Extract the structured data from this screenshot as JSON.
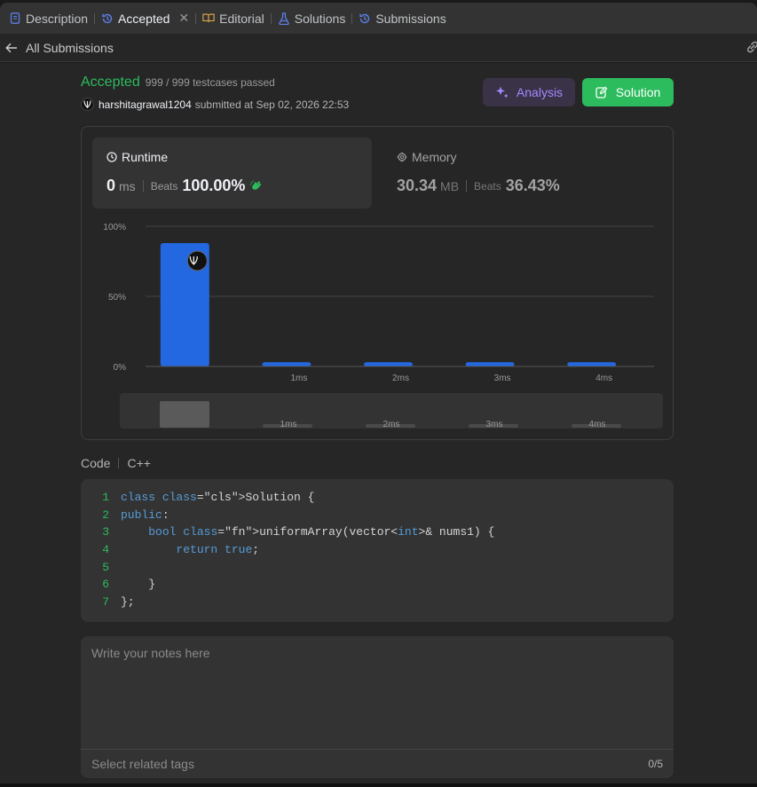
{
  "tabs": [
    {
      "label": "Description",
      "icon": "description-icon"
    },
    {
      "label": "Accepted",
      "icon": "history-icon",
      "active": true
    },
    {
      "label": "Editorial",
      "icon": "book-icon"
    },
    {
      "label": "Solutions",
      "icon": "flask-icon"
    },
    {
      "label": "Submissions",
      "icon": "history-icon"
    }
  ],
  "subheader": {
    "back_label": "All Submissions"
  },
  "submission": {
    "status": "Accepted",
    "testcases": "999 / 999 testcases passed",
    "username": "harshitagrawal1204",
    "submitted": "submitted at Sep 02, 2026 22:53"
  },
  "buttons": {
    "analysis": "Analysis",
    "solution": "Solution"
  },
  "runtime": {
    "title": "Runtime",
    "value": "0",
    "unit": "ms",
    "beats_label": "Beats",
    "beats": "100.00%"
  },
  "memory": {
    "title": "Memory",
    "value": "30.34",
    "unit": "MB",
    "beats_label": "Beats",
    "beats": "36.43%"
  },
  "colors": {
    "accent_green": "#2cbb5d",
    "bar_blue": "#2368e0",
    "analysis_purple": "#a48aff"
  },
  "chart_data": {
    "type": "bar",
    "categories": [
      "0ms",
      "1ms",
      "2ms",
      "3ms",
      "4ms"
    ],
    "tick_labels": [
      "",
      "1ms",
      "2ms",
      "3ms",
      "4ms"
    ],
    "values": [
      88,
      3,
      3,
      3,
      3
    ],
    "yticks": [
      "100%",
      "50%",
      "0%"
    ],
    "ylim": [
      0,
      100
    ],
    "highlight_index": 0,
    "grid": true,
    "minimap_labels": [
      "",
      "1ms",
      "2ms",
      "3ms",
      "4ms"
    ]
  },
  "code": {
    "label": "Code",
    "language": "C++",
    "lines": [
      "class Solution {",
      "public:",
      "    bool uniformArray(vector<int>& nums1) {",
      "        return true;",
      "",
      "    }",
      "};"
    ]
  },
  "notes": {
    "placeholder": "Write your notes here",
    "tags_placeholder": "Select related tags",
    "tags_count": "0/5"
  }
}
